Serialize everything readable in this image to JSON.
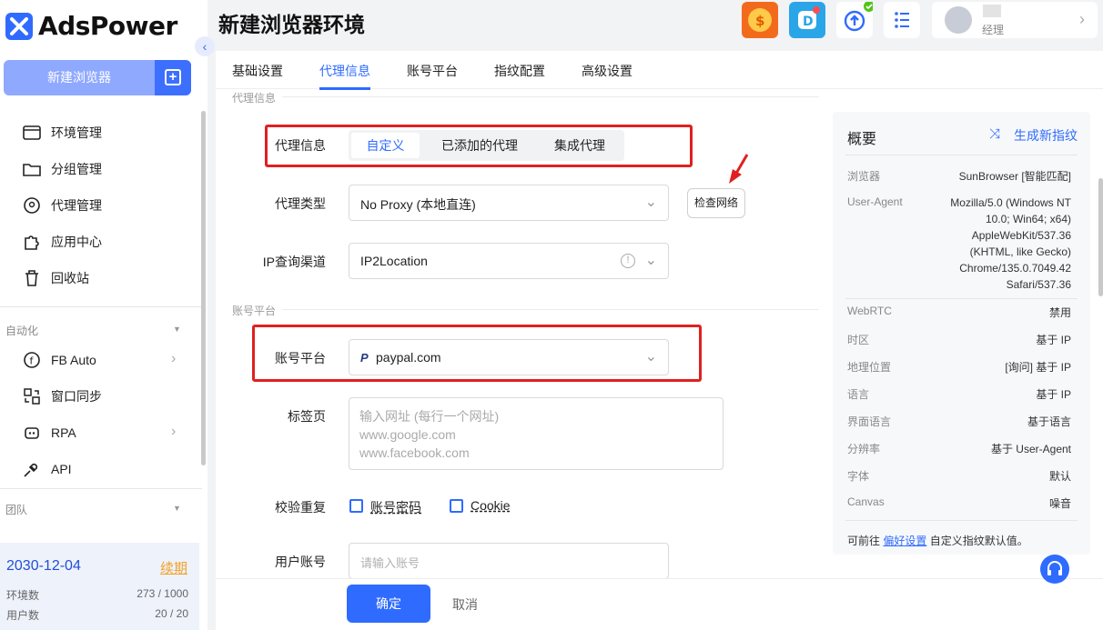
{
  "app": {
    "brand": "AdsPower",
    "page_title": "新建浏览器环境"
  },
  "sidebar": {
    "new_browser_label": "新建浏览器",
    "items": [
      {
        "label": "环境管理",
        "icon": "browser-window-icon"
      },
      {
        "label": "分组管理",
        "icon": "folder-icon"
      },
      {
        "label": "代理管理",
        "icon": "globe-pin-icon"
      },
      {
        "label": "应用中心",
        "icon": "puzzle-icon"
      },
      {
        "label": "回收站",
        "icon": "trash-icon"
      }
    ],
    "automation_label": "自动化",
    "automation_items": [
      {
        "label": "FB Auto",
        "icon": "facebook-icon"
      },
      {
        "label": "窗口同步",
        "icon": "sync-windows-icon"
      },
      {
        "label": "RPA",
        "icon": "robot-icon"
      },
      {
        "label": "API",
        "icon": "plug-icon"
      }
    ],
    "team_label": "团队",
    "expiry_date": "2030-12-04",
    "renew_label": "续期",
    "env_count_label": "环境数",
    "env_count_value": "273 / 1000",
    "user_count_label": "用户数",
    "user_count_value": "20 / 20"
  },
  "header": {
    "user_role": "经理"
  },
  "tabs": [
    "基础设置",
    "代理信息",
    "账号平台",
    "指纹配置",
    "高级设置"
  ],
  "active_tab": "代理信息",
  "form": {
    "proxy_section_title": "代理信息",
    "proxy_info_label": "代理信息",
    "proxy_modes": [
      "自定义",
      "已添加的代理",
      "集成代理"
    ],
    "proxy_type_label": "代理类型",
    "proxy_type_value": "No Proxy (本地直连)",
    "check_network_label": "检查网络",
    "ip_channel_label": "IP查询渠道",
    "ip_channel_value": "IP2Location",
    "account_section_title": "账号平台",
    "account_platform_label": "账号平台",
    "account_platform_value": "paypal.com",
    "tabs_label": "标签页",
    "tabs_placeholder_lines": [
      "输入网址 (每行一个网址)",
      "www.google.com",
      "www.facebook.com"
    ],
    "dedupe_label": "校验重复",
    "dedupe_opt1": "账号密码",
    "dedupe_opt2": "Cookie",
    "user_account_label": "用户账号",
    "user_account_placeholder": "请输入账号",
    "ok_label": "确定",
    "cancel_label": "取消"
  },
  "summary": {
    "title": "概要",
    "generate_label": "生成新指纹",
    "rows": [
      {
        "key": "浏览器",
        "value": "SunBrowser [智能匹配]"
      },
      {
        "key": "User-Agent",
        "value": "Mozilla/5.0 (Windows NT 10.0; Win64; x64) AppleWebKit/537.36 (KHTML, like Gecko) Chrome/135.0.7049.42 Safari/537.36"
      },
      {
        "key": "WebRTC",
        "value": "禁用"
      },
      {
        "key": "时区",
        "value": "基于 IP"
      },
      {
        "key": "地理位置",
        "value": "[询问] 基于 IP"
      },
      {
        "key": "语言",
        "value": "基于 IP"
      },
      {
        "key": "界面语言",
        "value": "基于语言"
      },
      {
        "key": "分辨率",
        "value": "基于 User-Agent"
      },
      {
        "key": "字体",
        "value": "默认"
      },
      {
        "key": "Canvas",
        "value": "噪音"
      }
    ],
    "ua_lines": [
      "Mozilla/5.0 (Windows NT",
      "10.0; Win64; x64)",
      "AppleWebKit/537.36",
      "(KHTML, like Gecko)",
      "Chrome/135.0.7049.42",
      "Safari/537.36"
    ],
    "footer_prefix": "可前往",
    "footer_link": "偏好设置",
    "footer_suffix": "自定义指纹默认值。"
  },
  "colors": {
    "accent": "#2f6bff",
    "highlight_box": "#e02020",
    "renew": "#f2a12a"
  }
}
